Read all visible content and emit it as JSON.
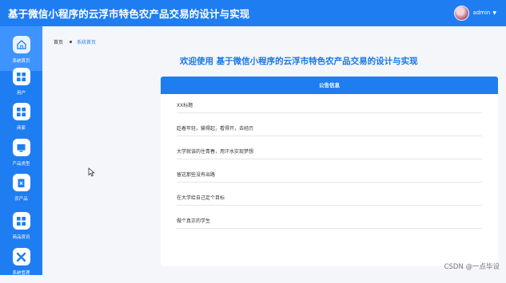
{
  "header": {
    "title": "基于微信小程序的云浮市特色农产品交易的设计与实现",
    "username": "admin"
  },
  "sidebar": {
    "items": [
      {
        "label": "系统首页",
        "icon": "home-icon",
        "active": true
      },
      {
        "label": "用户",
        "icon": "grid-icon"
      },
      {
        "label": "商家",
        "icon": "grid-icon"
      },
      {
        "label": "产品类型",
        "icon": "folder-icon"
      },
      {
        "label": "农产品",
        "icon": "clipboard-icon"
      },
      {
        "label": "商品资讯",
        "icon": "grid-icon"
      },
      {
        "label": "系统管理",
        "icon": "tools-icon"
      }
    ]
  },
  "breadcrumb": {
    "home": "首页",
    "current": "系统首页"
  },
  "welcome": "欢迎使用 基于微信小程序的云浮市特色农产品交易的设计与实现",
  "notice": {
    "title": "公告信息",
    "items": [
      "XX标题",
      "趁着年轻，输得起，看得开，去经历",
      "大学就该的住青春，用汗水实现梦想",
      "留这那些没有出路",
      "在大学给自己定个目标",
      "做个真正的学生"
    ]
  },
  "watermark": "CSDN @一点毕设",
  "colors": {
    "primary": "#1f7df2",
    "accent": "#1777e8"
  }
}
